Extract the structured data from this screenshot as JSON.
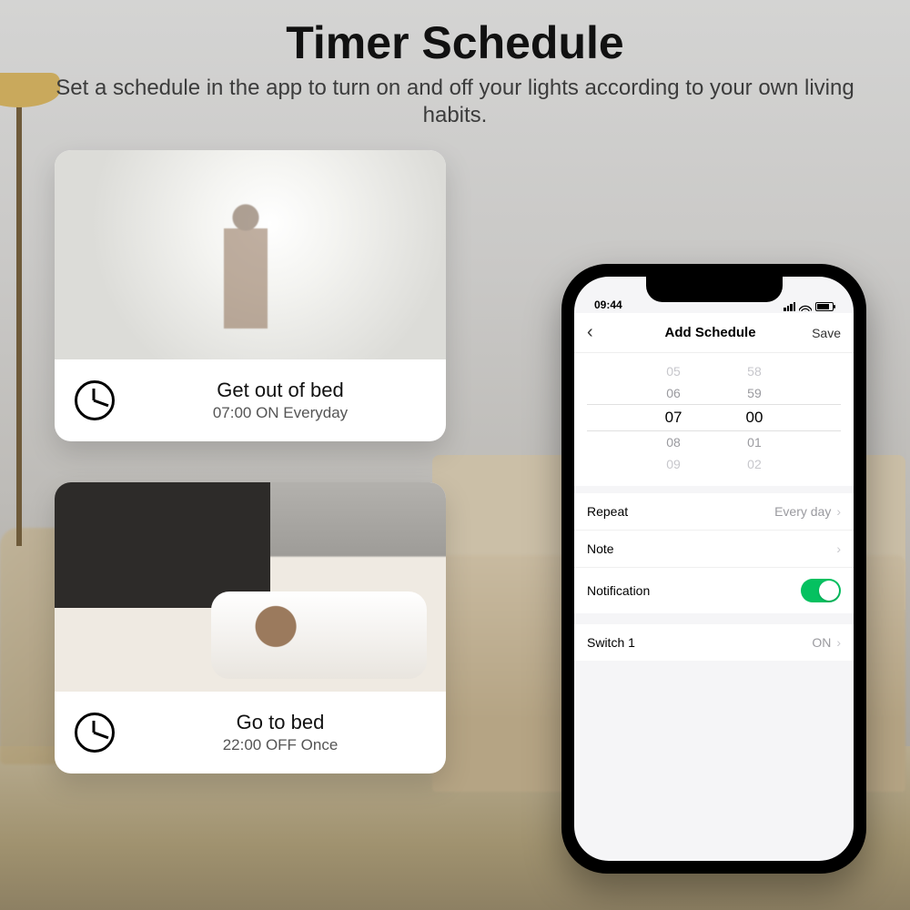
{
  "hero": {
    "title": "Timer Schedule",
    "subtitle": "Set a schedule in the app to turn on and off your lights according to your own living habits."
  },
  "cards": [
    {
      "title": "Get out of bed",
      "detail": "07:00 ON Everyday"
    },
    {
      "title": "Go to bed",
      "detail": "22:00 OFF Once"
    }
  ],
  "phone": {
    "status_time": "09:44",
    "nav": {
      "title": "Add Schedule",
      "save": "Save"
    },
    "picker": {
      "hours": [
        "05",
        "06",
        "07",
        "08",
        "09"
      ],
      "minutes": [
        "58",
        "59",
        "00",
        "01",
        "02"
      ],
      "selected_index": 2
    },
    "rows": {
      "repeat_label": "Repeat",
      "repeat_value": "Every day",
      "note_label": "Note",
      "notification_label": "Notification",
      "switch_label": "Switch 1",
      "switch_value": "ON"
    }
  }
}
